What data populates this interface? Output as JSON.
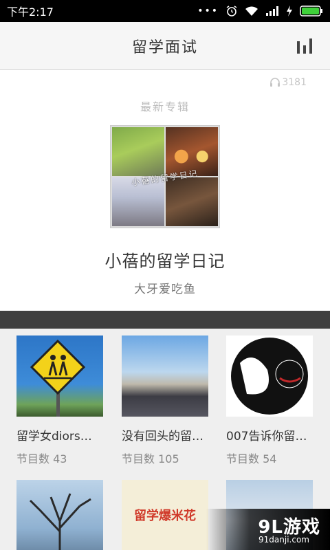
{
  "status_bar": {
    "time": "下午2:17",
    "icons": [
      "more-dots-icon",
      "alarm-icon",
      "wifi-icon",
      "signal-icon",
      "charging-icon",
      "battery-icon"
    ]
  },
  "header": {
    "title": "留学面试",
    "right_icon": "bar-chart-icon"
  },
  "featured": {
    "listen_icon": "headphones-icon",
    "listen_count": "3181",
    "section_label": "最新专辑",
    "cover_text": "小蓓的留学日记",
    "title": "小蓓的留学日记",
    "author": "大牙爱吃鱼"
  },
  "albums": [
    {
      "title": "留学女diors…",
      "count_label": "节目数 43"
    },
    {
      "title": "没有回头的留…",
      "count_label": "节目数 105"
    },
    {
      "title": "007告诉你留…",
      "count_label": "节目数 54"
    },
    {
      "title": "",
      "count_label": ""
    },
    {
      "title": "",
      "count_label": ""
    },
    {
      "title": "",
      "count_label": ""
    }
  ],
  "thumb_texts": {
    "t5": "留学爆米花"
  },
  "watermark": {
    "main": "9L游戏",
    "sub": "91danji.com"
  },
  "colors": {
    "accent_battery": "#3fd13a",
    "band": "#3f3f3f",
    "title_text": "#333333"
  }
}
